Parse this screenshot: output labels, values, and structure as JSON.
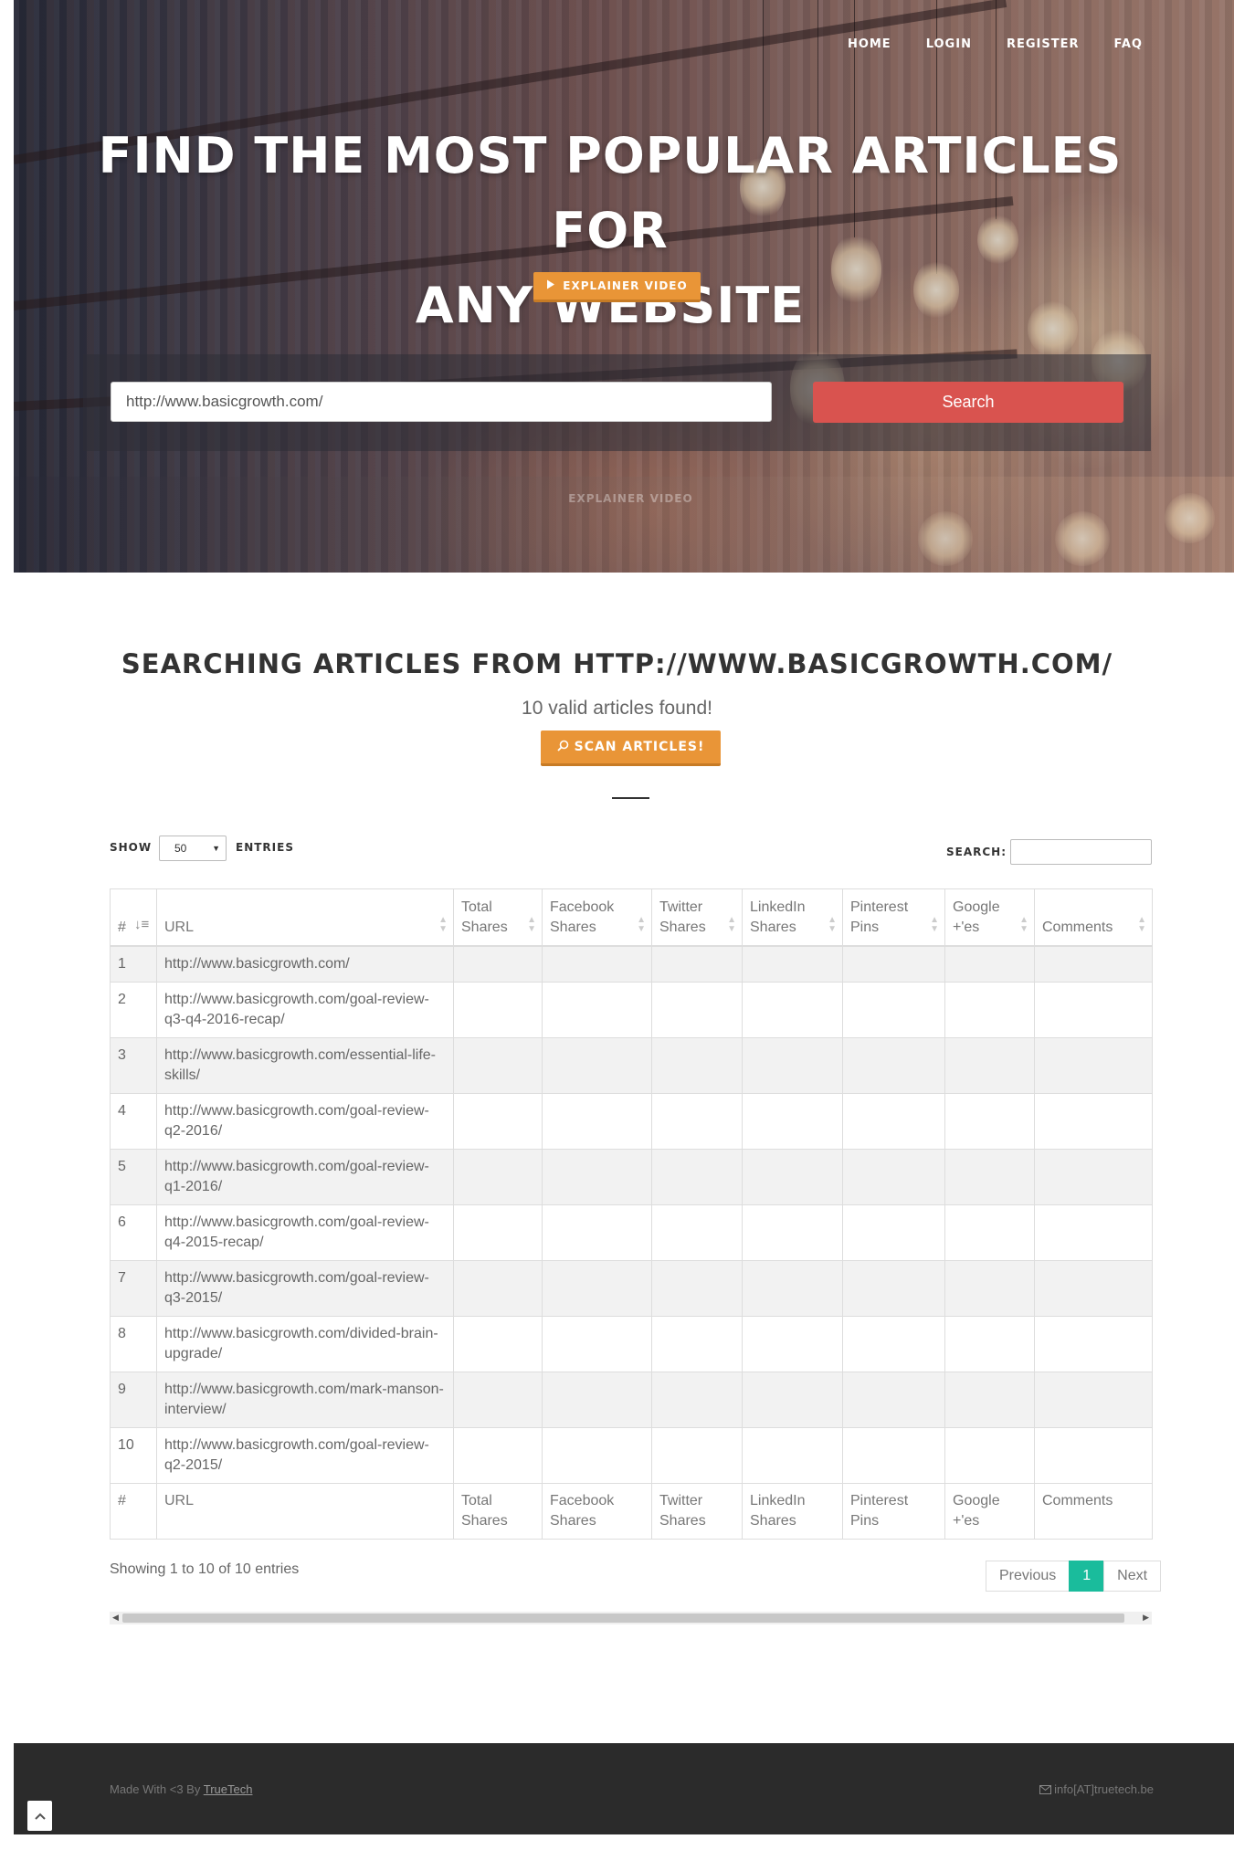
{
  "nav": {
    "items": [
      {
        "label": "HOME"
      },
      {
        "label": "LOGIN"
      },
      {
        "label": "REGISTER"
      },
      {
        "label": "FAQ"
      }
    ]
  },
  "hero": {
    "title_line1": "FIND THE MOST POPULAR ARTICLES FOR",
    "title_line2": "ANY WEBSITE",
    "explainer_label": "EXPLAINER VIDEO",
    "ghost_label": "EXPLAINER VIDEO",
    "search_value": "http://www.basicgrowth.com/",
    "search_button": "Search"
  },
  "results": {
    "title": "SEARCHING ARTICLES FROM HTTP://WWW.BASICGROWTH.COM/",
    "found_text": "10 valid articles found!",
    "scan_label": "SCAN ARTICLES!"
  },
  "table_controls": {
    "show_label": "SHOW",
    "entries_label": "ENTRIES",
    "length_value": "50",
    "search_label": "SEARCH:",
    "search_value": ""
  },
  "table": {
    "columns": [
      "#",
      "URL",
      "Total Shares",
      "Facebook Shares",
      "Twitter Shares",
      "LinkedIn Shares",
      "Pinterest Pins",
      "Google +'es",
      "Comments"
    ],
    "rows": [
      {
        "num": "1",
        "url": "http://www.basicgrowth.com/"
      },
      {
        "num": "2",
        "url": "http://www.basicgrowth.com/goal-review-q3-q4-2016-recap/"
      },
      {
        "num": "3",
        "url": "http://www.basicgrowth.com/essential-life-skills/"
      },
      {
        "num": "4",
        "url": "http://www.basicgrowth.com/goal-review-q2-2016/"
      },
      {
        "num": "5",
        "url": "http://www.basicgrowth.com/goal-review-q1-2016/"
      },
      {
        "num": "6",
        "url": "http://www.basicgrowth.com/goal-review-q4-2015-recap/"
      },
      {
        "num": "7",
        "url": "http://www.basicgrowth.com/goal-review-q3-2015/"
      },
      {
        "num": "8",
        "url": "http://www.basicgrowth.com/divided-brain-upgrade/"
      },
      {
        "num": "9",
        "url": "http://www.basicgrowth.com/mark-manson-interview/"
      },
      {
        "num": "10",
        "url": "http://www.basicgrowth.com/goal-review-q2-2015/"
      }
    ],
    "info": "Showing 1 to 10 of 10 entries",
    "pager": {
      "previous": "Previous",
      "current": "1",
      "next": "Next"
    }
  },
  "footer": {
    "made_with": "Made With <3 By ",
    "author_link": "TrueTech",
    "email": "info[AT]truetech.be"
  },
  "icons": {
    "play": "play-icon",
    "search": "search-icon",
    "envelope": "envelope-icon",
    "back_to_top": "chevron-up-icon"
  },
  "colors": {
    "accent_orange": "#e99537",
    "search_red": "#d9534f",
    "pager_active": "#1abc9c",
    "footer_bg": "#2b2b2b"
  }
}
